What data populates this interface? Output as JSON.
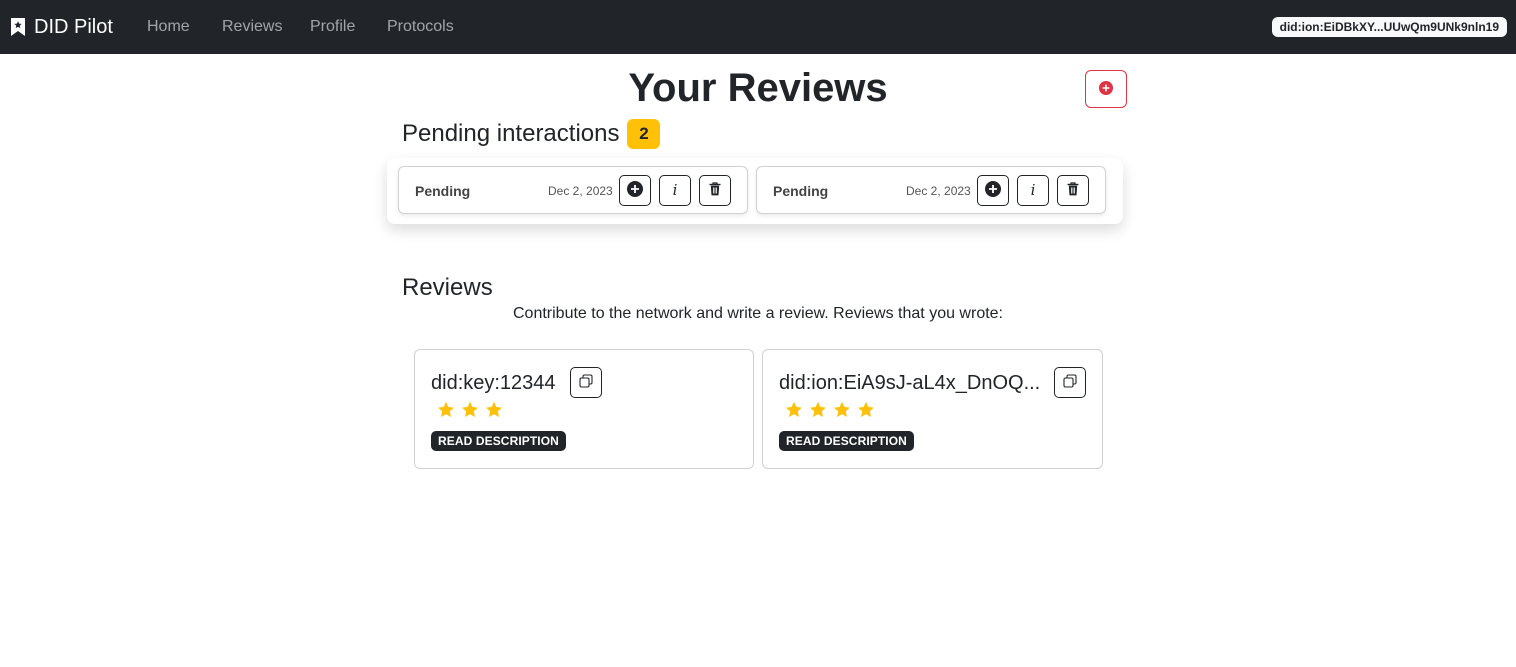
{
  "navbar": {
    "brand": "DID Pilot",
    "brand_icon": "bookmark-star-icon",
    "links": [
      "Home",
      "Reviews",
      "Profile",
      "Protocols"
    ],
    "did": "did:ion:EiDBkXY...UUwQm9UNk9nln19"
  },
  "header": {
    "title": "Your Reviews",
    "add_icon": "plus-circle-icon",
    "accent_color": "#dc3545"
  },
  "pending": {
    "heading": "Pending interactions",
    "count": "2",
    "badge_color": "#ffc107",
    "items": [
      {
        "status": "Pending",
        "date": "Dec 2, 2023"
      },
      {
        "status": "Pending",
        "date": "Dec 2, 2023"
      }
    ]
  },
  "reviews": {
    "heading": "Reviews",
    "subtitle": "Contribute to the network and write a review. Reviews that you wrote:",
    "star_color": "#ffc107",
    "items": [
      {
        "did": "did:key:12344",
        "stars": 3,
        "button": "READ DESCRIPTION"
      },
      {
        "did": "did:ion:EiA9sJ-aL4x_DnOQ...",
        "stars": 4,
        "button": "READ DESCRIPTION"
      }
    ]
  }
}
